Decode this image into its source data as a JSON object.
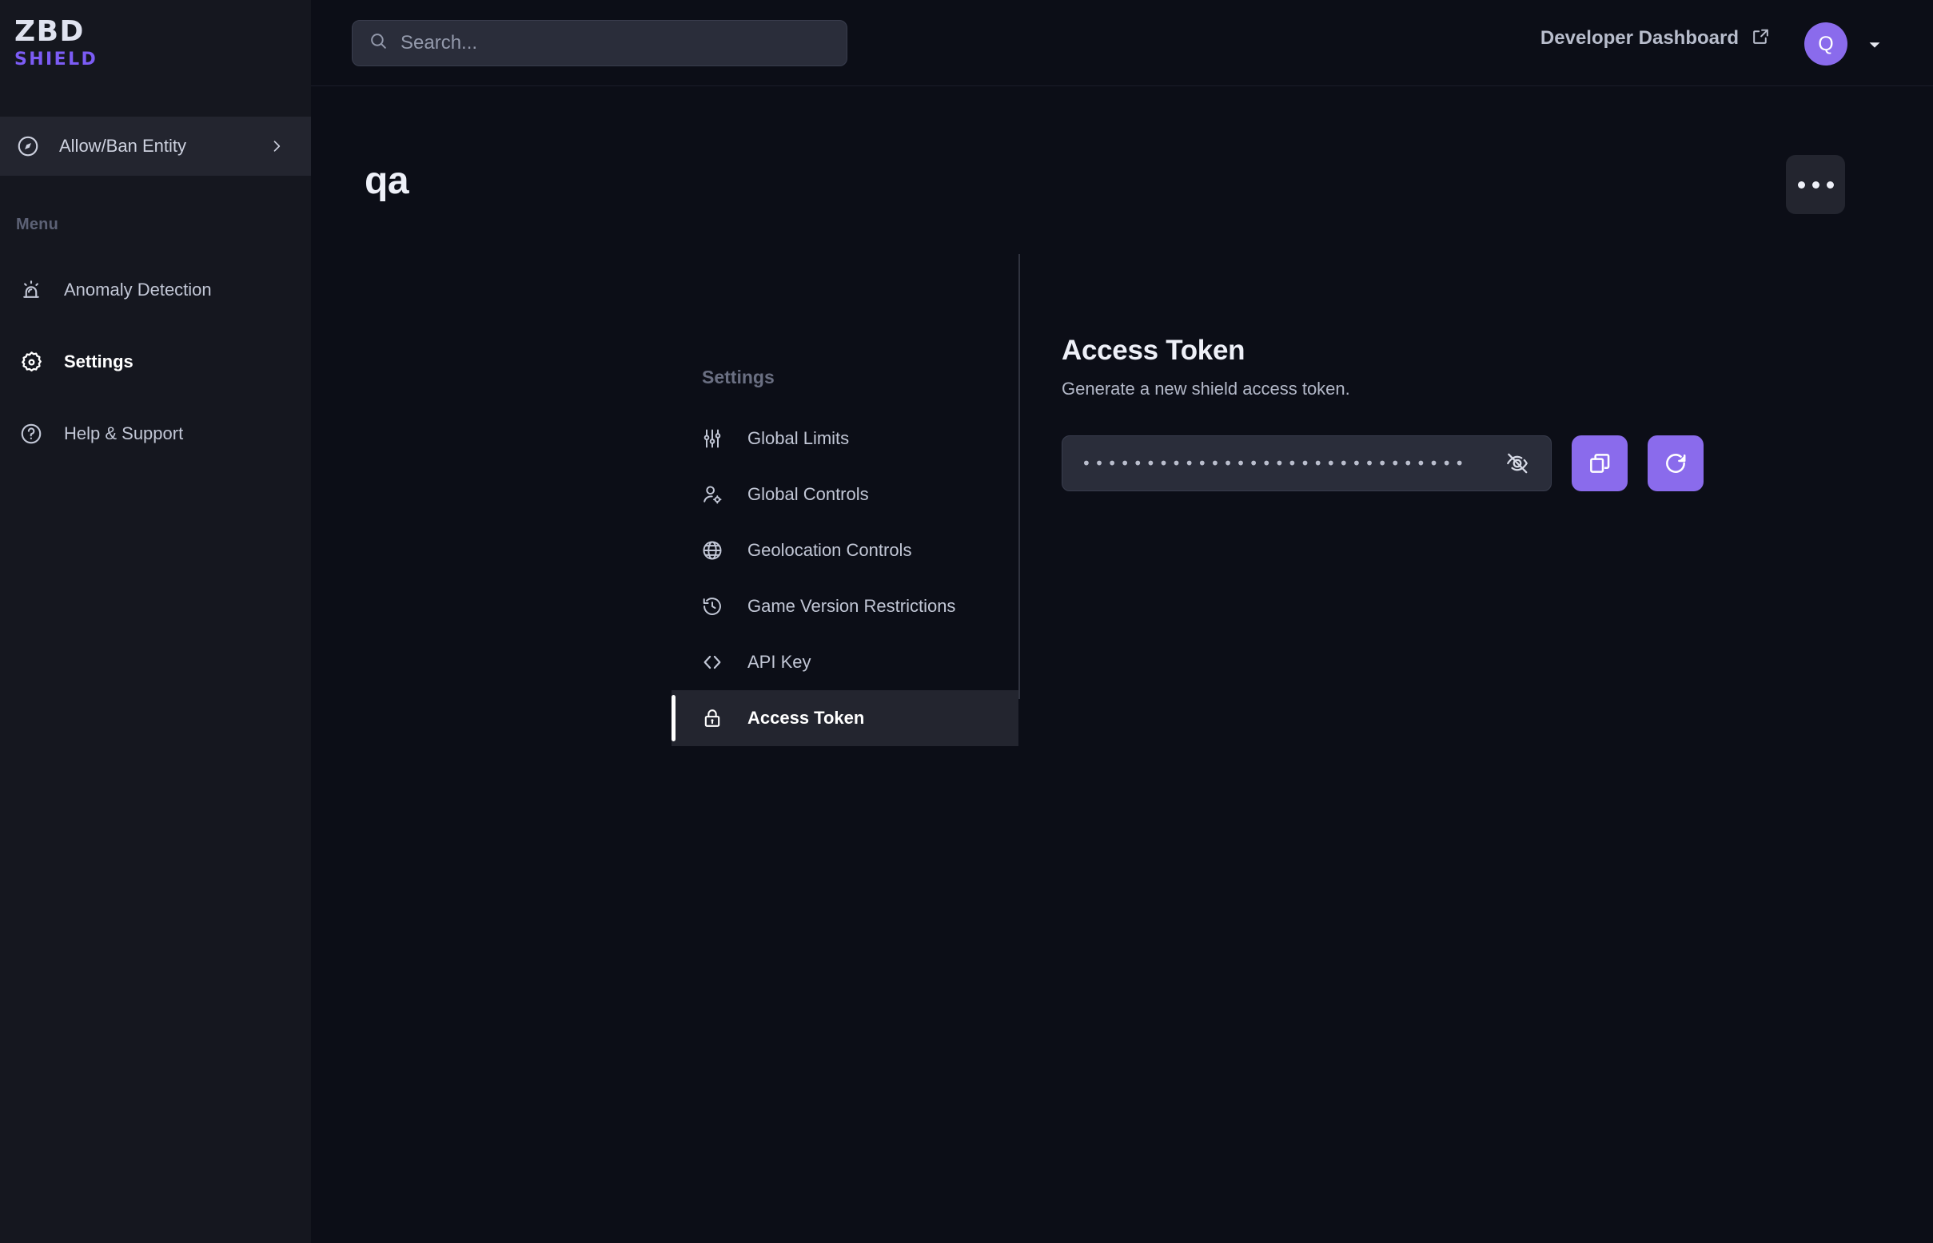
{
  "brand": {
    "name": "ZBD",
    "product": "SHIELD"
  },
  "topbar": {
    "search_placeholder": "Search...",
    "developer_dashboard": "Developer Dashboard",
    "avatar_initial": "Q"
  },
  "sidebar": {
    "allow_ban": {
      "label": "Allow/Ban Entity"
    },
    "menu_label": "Menu",
    "items": [
      {
        "label": "Anomaly Detection",
        "icon": "siren-icon",
        "active": false
      },
      {
        "label": "Settings",
        "icon": "gear-icon",
        "active": true
      },
      {
        "label": "Help & Support",
        "icon": "question-circle-icon",
        "active": false
      }
    ]
  },
  "page": {
    "title": "qa",
    "overflow_label": "..."
  },
  "settings": {
    "section_label": "Settings",
    "items": [
      {
        "label": "Global Limits",
        "icon": "sliders-icon",
        "active": false
      },
      {
        "label": "Global Controls",
        "icon": "user-gear-icon",
        "active": false
      },
      {
        "label": "Geolocation Controls",
        "icon": "globe-icon",
        "active": false
      },
      {
        "label": "Game Version Restrictions",
        "icon": "history-icon",
        "active": false
      },
      {
        "label": "API Key",
        "icon": "code-brackets-icon",
        "active": false
      },
      {
        "label": "Access Token",
        "icon": "lock-icon",
        "active": true
      }
    ]
  },
  "detail": {
    "heading": "Access Token",
    "description": "Generate a new shield access token.",
    "token_masked": "••••••••••••••••••••••••••••••",
    "copy_label": "Copy",
    "regenerate_label": "Regenerate"
  },
  "colors": {
    "accent_purple": "#8a6bec",
    "brand_purple": "#7c5cf5",
    "background": "#0c0e17",
    "sidebar": "#15171f",
    "panel": "#23252f",
    "field": "#2a2d3a"
  }
}
